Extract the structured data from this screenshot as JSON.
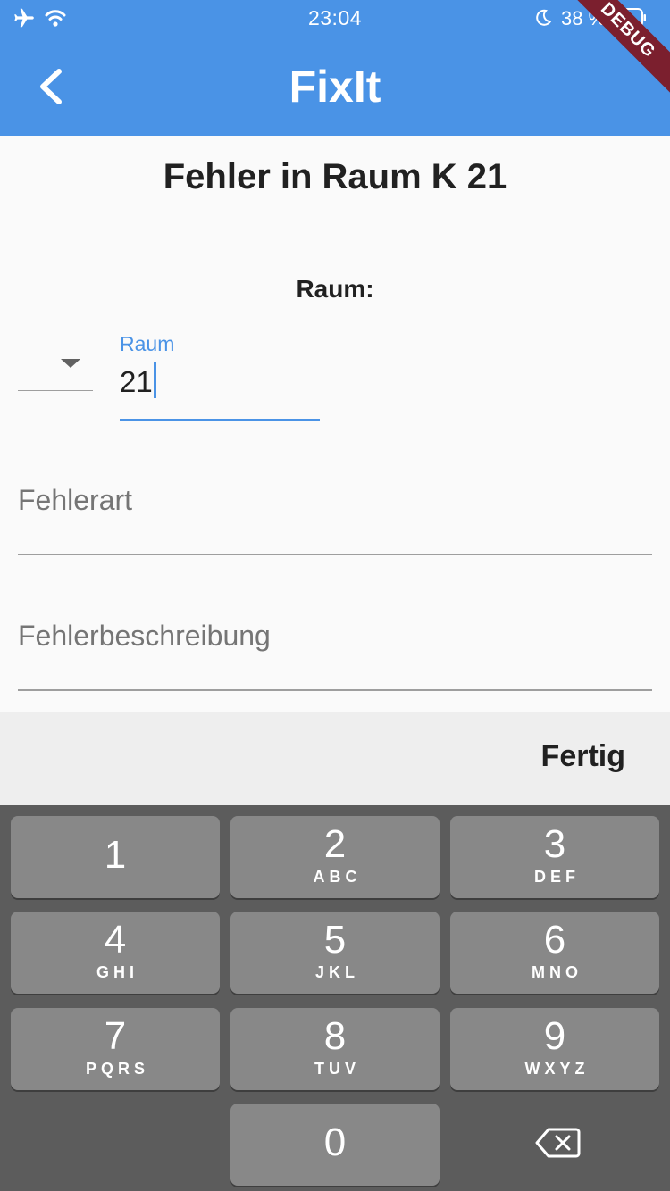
{
  "status_bar": {
    "time": "23:04",
    "battery_text": "38 %",
    "icons": [
      "airplane-icon",
      "wifi-icon",
      "moon-icon",
      "battery-icon"
    ]
  },
  "app_bar": {
    "title": "FixIt",
    "back_icon": "chevron-left-icon",
    "debug_banner": "DEBUG",
    "color": "#4a93e6"
  },
  "form": {
    "heading": "Fehler in Raum K 21",
    "room_label": "Raum:",
    "room_field": {
      "label": "Raum",
      "value": "21"
    },
    "fault_type": {
      "placeholder": "Fehlerart"
    },
    "fault_description": {
      "placeholder": "Fehlerbeschreibung"
    }
  },
  "accessory": {
    "done_label": "Fertig"
  },
  "keypad": {
    "keys": [
      {
        "digit": "1",
        "letters": ""
      },
      {
        "digit": "2",
        "letters": "ABC"
      },
      {
        "digit": "3",
        "letters": "DEF"
      },
      {
        "digit": "4",
        "letters": "GHI"
      },
      {
        "digit": "5",
        "letters": "JKL"
      },
      {
        "digit": "6",
        "letters": "MNO"
      },
      {
        "digit": "7",
        "letters": "PQRS"
      },
      {
        "digit": "8",
        "letters": "TUV"
      },
      {
        "digit": "9",
        "letters": "WXYZ"
      },
      {
        "digit": "0",
        "letters": ""
      }
    ],
    "delete_icon": "backspace-icon"
  }
}
